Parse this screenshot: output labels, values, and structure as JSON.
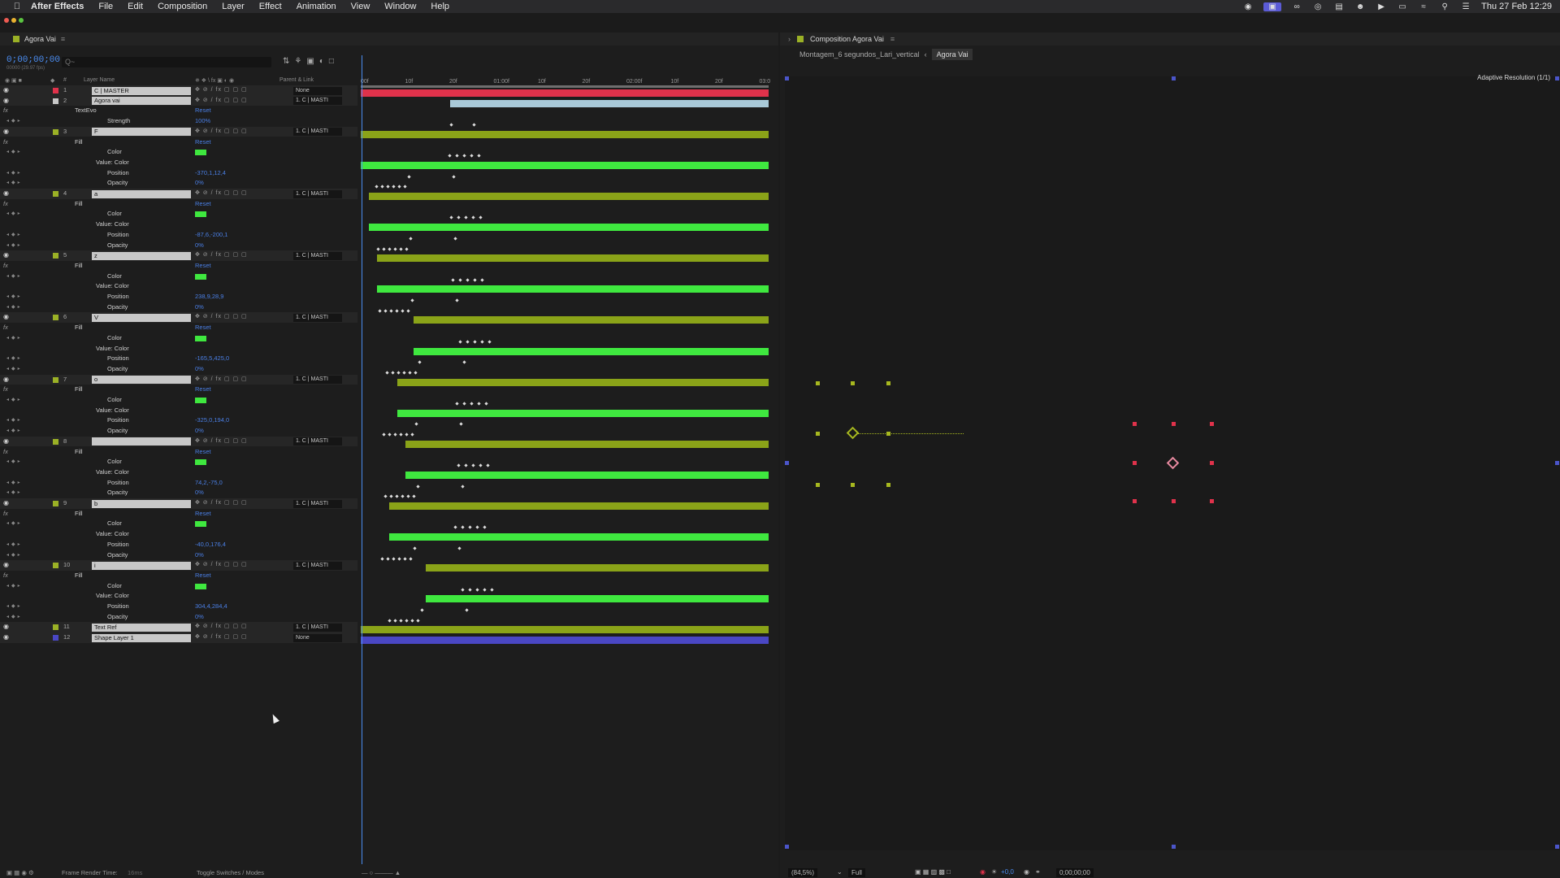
{
  "menubar": {
    "app": "After Effects",
    "items": [
      "File",
      "Edit",
      "Composition",
      "Layer",
      "Effect",
      "Animation",
      "View",
      "Window",
      "Help"
    ],
    "clock": "Thu 27 Feb  12:29"
  },
  "timeline": {
    "tab_title": "Agora Vai",
    "timecode": "0;00;00;00",
    "fps": "00000 (29.97 fps)",
    "search_placeholder": "Q~",
    "columns": {
      "num": "#",
      "layer_name": "Layer Name",
      "parent": "Parent & Link"
    },
    "ruler_labels": [
      "00f",
      "10f",
      "20f",
      "01:00f",
      "10f",
      "20f",
      "02:00f",
      "10f",
      "20f",
      "03:0"
    ],
    "layers": [
      {
        "num": "1",
        "name": "C | MASTER",
        "parent": "None",
        "label_color": "#e0324b",
        "bar_color": "#e0324b",
        "bar_start": 0.0,
        "bar_end": 1.0
      },
      {
        "num": "2",
        "name": "Agora vai",
        "parent": "1. C | MASTI",
        "label_color": "#c8c8c8",
        "bar_color": "#a9c9d8",
        "bar_start": 0.22,
        "bar_end": 1.0
      },
      {
        "num": "3",
        "name": "F",
        "parent": "1. C | MASTI",
        "label_color": "#9bb126",
        "bar_color": "#8aa318",
        "bar_start": 0.0,
        "bar_end": 1.0,
        "position": "-370,1,12,4",
        "opacity": "0%"
      },
      {
        "num": "4",
        "name": "a",
        "parent": "1. C | MASTI",
        "label_color": "#9bb126",
        "bar_color": "#8aa318",
        "bar_start": 0.02,
        "bar_end": 1.0,
        "position": "-87,6,-200,1",
        "opacity": "0%"
      },
      {
        "num": "5",
        "name": "z",
        "parent": "1. C | MASTI",
        "label_color": "#9bb126",
        "bar_color": "#8aa318",
        "bar_start": 0.04,
        "bar_end": 1.0,
        "position": "238,9,28,9",
        "opacity": "0%"
      },
      {
        "num": "6",
        "name": "V",
        "parent": "1. C | MASTI",
        "label_color": "#9bb126",
        "bar_color": "#8aa318",
        "bar_start": 0.13,
        "bar_end": 1.0,
        "position": "-165,5,425,0",
        "opacity": "0%"
      },
      {
        "num": "7",
        "name": "o",
        "parent": "1. C | MASTI",
        "label_color": "#9bb126",
        "bar_color": "#8aa318",
        "bar_start": 0.09,
        "bar_end": 1.0,
        "position": "-325,0,194,0",
        "opacity": "0%"
      },
      {
        "num": "8",
        "name": "",
        "parent": "1. C | MASTI",
        "label_color": "#9bb126",
        "bar_color": "#8aa318",
        "bar_start": 0.11,
        "bar_end": 1.0,
        "position": "74,2,-75,0",
        "opacity": "0%"
      },
      {
        "num": "9",
        "name": "b",
        "parent": "1. C | MASTI",
        "label_color": "#9bb126",
        "bar_color": "#8aa318",
        "bar_start": 0.07,
        "bar_end": 1.0,
        "position": "-40,0,176,4",
        "opacity": "0%"
      },
      {
        "num": "10",
        "name": "i",
        "parent": "1. C | MASTI",
        "label_color": "#9bb126",
        "bar_color": "#8aa318",
        "bar_start": 0.16,
        "bar_end": 1.0,
        "position": "304,4,284,4",
        "opacity": "0%"
      },
      {
        "num": "11",
        "name": "Text Ref",
        "parent": "1. C | MASTI",
        "label_color": "#9bb126",
        "bar_color": "#8aa318",
        "bar_start": 0.0,
        "bar_end": 1.0
      },
      {
        "num": "12",
        "name": "Shape Layer 1",
        "parent": "None",
        "label_color": "#4a47c4",
        "bar_color": "#4a47c4",
        "bar_start": 0.0,
        "bar_end": 1.0
      }
    ],
    "text_effect": {
      "group": "TextEvo",
      "reset": "Reset",
      "prop": "Strength",
      "value": "100%"
    },
    "fill_labels": {
      "group": "Fill",
      "reset": "Reset",
      "color": "Color",
      "value_color": "Value: Color",
      "position": "Position",
      "opacity": "Opacity"
    }
  },
  "status": {
    "render_time_label": "Frame Render Time:",
    "render_time": "16ms",
    "toggle": "Toggle Switches / Modes"
  },
  "composition": {
    "tab_title": "Composition Agora Vai",
    "breadcrumbs": [
      "Montagem_6 segundos_Lari_vertical",
      "Agora Vai"
    ],
    "adaptive": "Adaptive Resolution (1/1)",
    "zoom": "(84,5%)",
    "quality": "Full",
    "timecode": "0;00;00;00",
    "exposure": "+0,0"
  },
  "colors": {
    "accent": "#4a8cf0",
    "keyframe_green": "#3fe83f",
    "handle_yellow": "#a7b81f",
    "handle_red": "#e0324b"
  }
}
